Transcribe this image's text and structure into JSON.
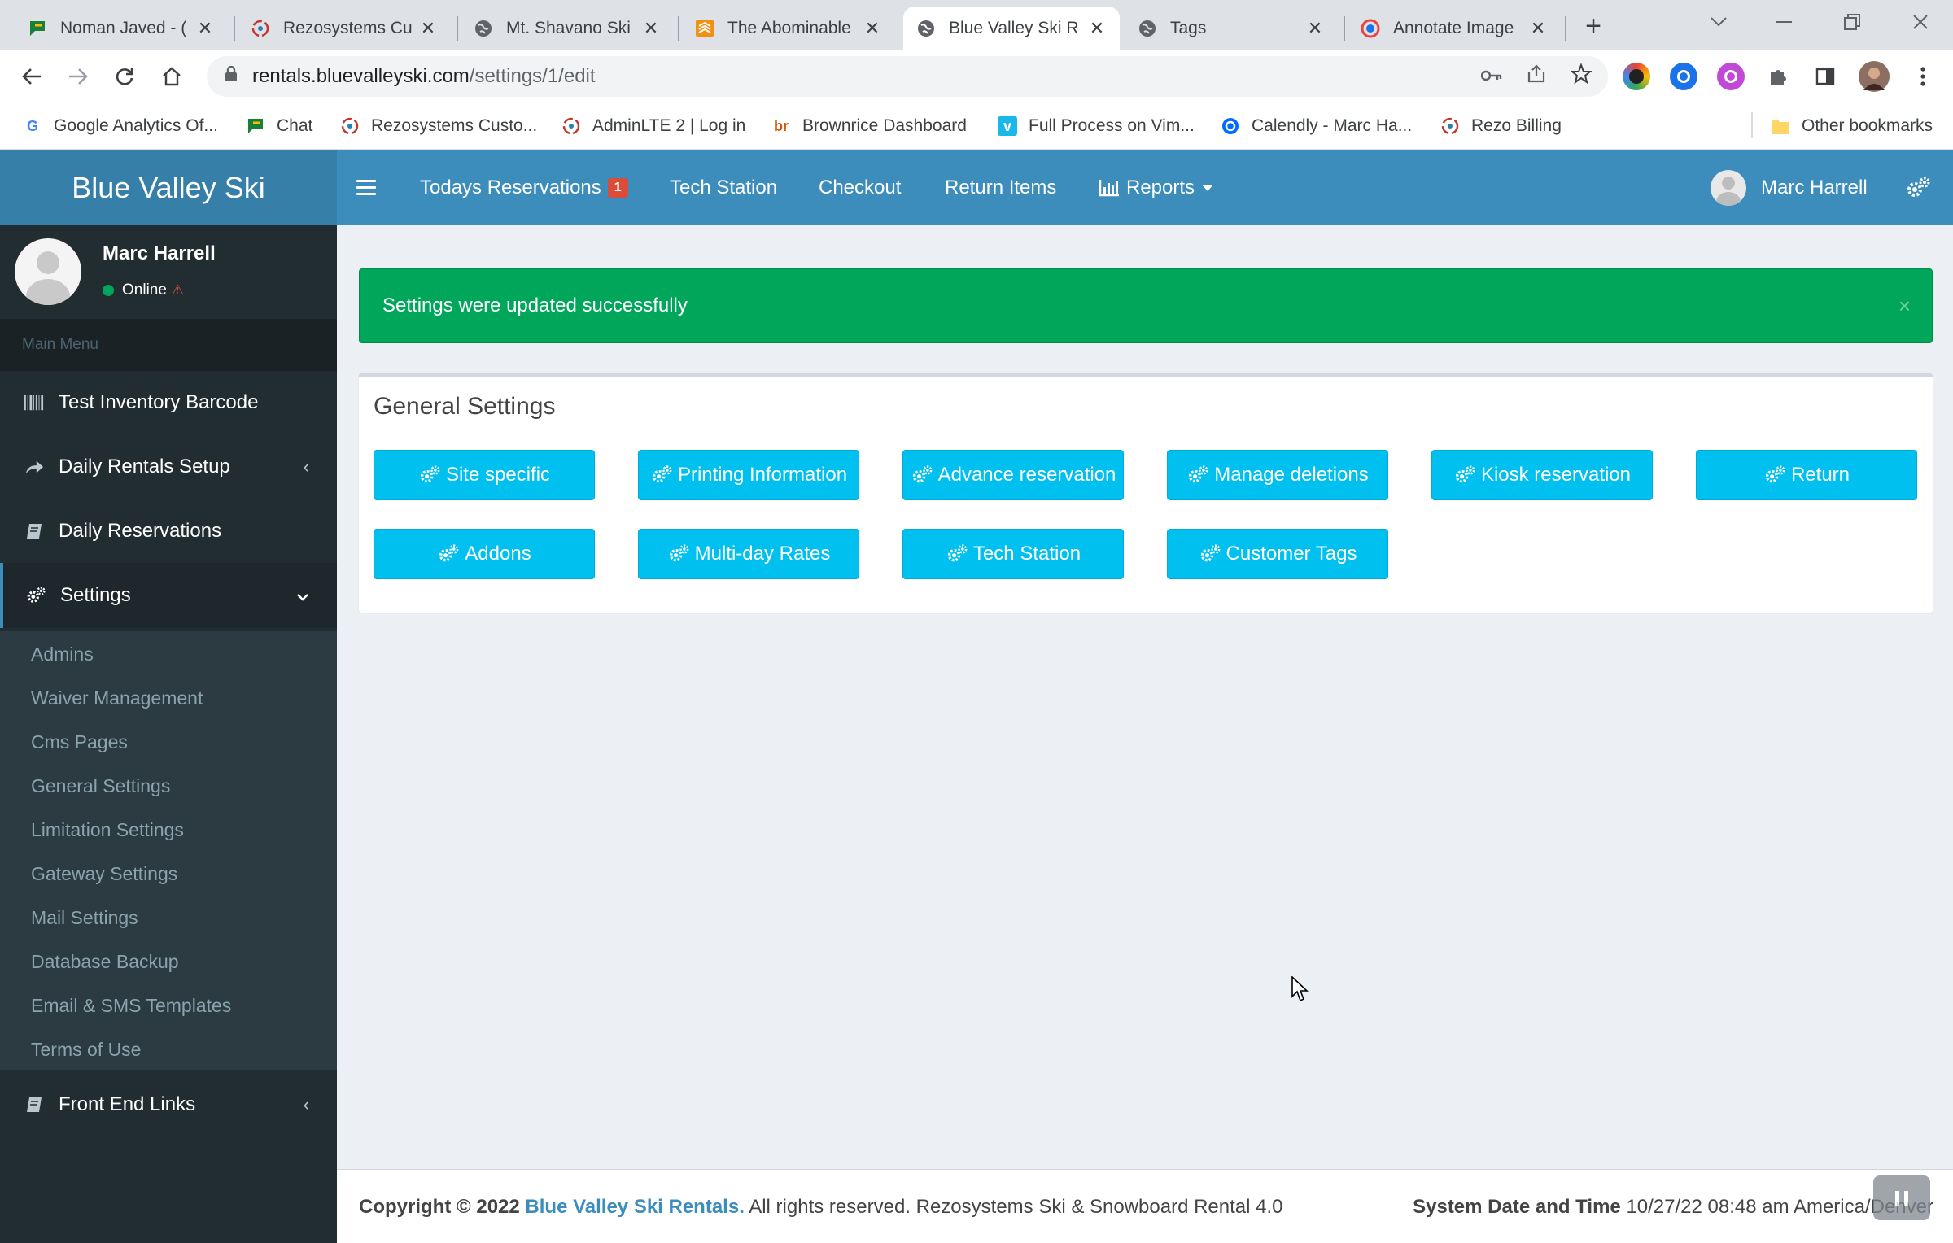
{
  "browser": {
    "tabs": [
      {
        "title": "Noman Javed - (",
        "icon": "chat-icon"
      },
      {
        "title": "Rezosystems Cu",
        "icon": "rezo-icon"
      },
      {
        "title": "Mt. Shavano Ski",
        "icon": "globe-icon"
      },
      {
        "title": "The Abominable",
        "icon": "layers-icon"
      },
      {
        "title": "Blue Valley Ski R",
        "icon": "globe-icon",
        "active": true
      },
      {
        "title": "Tags",
        "icon": "globe-icon"
      },
      {
        "title": "Annotate Image",
        "icon": "annotate-icon"
      }
    ],
    "url_host": "rentals.bluevalleyski.com",
    "url_path": "/settings/1/edit",
    "bookmarks": [
      {
        "label": "Google Analytics Of...",
        "icon": "google-icon"
      },
      {
        "label": "Chat",
        "icon": "chat-icon"
      },
      {
        "label": "Rezosystems Custo...",
        "icon": "rezo-icon"
      },
      {
        "label": "AdminLTE 2 | Log in",
        "icon": "rezo-icon"
      },
      {
        "label": "Brownrice Dashboard",
        "icon": "brownrice-icon"
      },
      {
        "label": "Full Process on Vim...",
        "icon": "vimeo-icon"
      },
      {
        "label": "Calendly - Marc Ha...",
        "icon": "calendly-icon"
      },
      {
        "label": "Rezo Billing",
        "icon": "rezo-icon"
      }
    ],
    "other_bookmarks": "Other bookmarks"
  },
  "app": {
    "brand": "Blue Valley Ski",
    "topnav": {
      "reservations": "Todays Reservations",
      "reservations_badge": "1",
      "tech_station": "Tech Station",
      "checkout": "Checkout",
      "return_items": "Return Items",
      "reports": "Reports",
      "user_name": "Marc Harrell"
    },
    "sidebar": {
      "user_name": "Marc Harrell",
      "status": "Online",
      "menu_header": "Main Menu",
      "items": [
        {
          "label": "Test Inventory Barcode",
          "icon": "barcode-icon"
        },
        {
          "label": "Daily Rentals Setup",
          "icon": "share-icon"
        },
        {
          "label": "Daily Reservations",
          "icon": "book-icon"
        },
        {
          "label": "Settings",
          "icon": "gears-icon"
        },
        {
          "label": "Front End Links",
          "icon": "book-icon"
        }
      ],
      "settings_submenu": [
        "Admins",
        "Waiver Management",
        "Cms Pages",
        "General Settings",
        "Limitation Settings",
        "Gateway Settings",
        "Mail Settings",
        "Database Backup",
        "Email & SMS Templates",
        "Terms of Use"
      ]
    },
    "alert": {
      "message": "Settings were updated successfully",
      "close": "×"
    },
    "general_settings": {
      "title": "General Settings",
      "buttons": [
        "Site specific",
        "Printing Information",
        "Advance reservation",
        "Manage deletions",
        "Kiosk reservation",
        "Return",
        "Addons",
        "Multi-day Rates",
        "Tech Station",
        "Customer Tags"
      ]
    },
    "footer": {
      "copyright_prefix": "Copyright © 2022",
      "brand_link": "Blue Valley Ski Rentals.",
      "rights": "All rights reserved. Rezosystems Ski & Snowboard Rental 4.0",
      "datetime_label": "System Date and Time",
      "datetime_value": "10/27/22 08:48 am America/Denver"
    },
    "colors": {
      "header": "#3c8dbc",
      "logo": "#367fa9",
      "sidebar": "#222d32",
      "success": "#00a65a",
      "info_button": "#00c0ef",
      "badge": "#dd4b39"
    }
  }
}
